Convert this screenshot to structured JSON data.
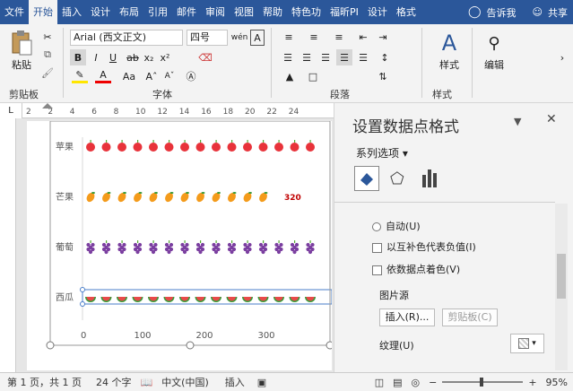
{
  "tabs": [
    "文件",
    "开始",
    "插入",
    "设计",
    "布局",
    "引用",
    "邮件",
    "审阅",
    "视图",
    "帮助",
    "特色功",
    "福昕PI",
    "设计",
    "格式"
  ],
  "active_tab": "开始",
  "tell_me": "告诉我",
  "share": "共享",
  "ribbon": {
    "paste": "粘贴",
    "clipboard": "剪贴板",
    "font_name": "Arial (西文正文)",
    "font_size": "四号",
    "font_group": "字体",
    "paragraph_group": "段落",
    "styles": "样式",
    "styles_group": "样式",
    "editing": "编辑",
    "wen": "wén",
    "bold": "B",
    "italic": "I",
    "underline": "U",
    "aa": "Aa"
  },
  "ruler_ticks": [
    "2",
    "2",
    "4",
    "6",
    "8",
    "10",
    "12",
    "14",
    "16",
    "18",
    "20",
    "22",
    "24"
  ],
  "chart_data": {
    "type": "bar",
    "categories": [
      "苹果",
      "芒果",
      "葡萄",
      "西瓜"
    ],
    "values": [
      null,
      320,
      null,
      null
    ],
    "data_label": "320",
    "x_ticks": [
      "0",
      "100",
      "200",
      "300"
    ],
    "icons": [
      "apple",
      "mango",
      "grape",
      "watermelon"
    ],
    "colors": {
      "apple": "#e8333a",
      "mango": "#f49b1b",
      "grape": "#7b3fa0",
      "watermelon": "#3a9b3a",
      "label": "#c00000"
    }
  },
  "pane": {
    "title": "设置数据点格式",
    "series_options": "系列选项",
    "auto": "自动(U)",
    "invert": "以互补色代表负值(I)",
    "vary_colors": "依数据点着色(V)",
    "picture_source": "图片源",
    "insert_btn": "插入(R)...",
    "clipboard_btn": "剪贴板(C)",
    "texture": "纹理(U)"
  },
  "status": {
    "page": "第 1 页，共 1 页",
    "words": "24 个字",
    "lang": "中文(中国)",
    "mode": "插入",
    "zoom": "95%"
  }
}
